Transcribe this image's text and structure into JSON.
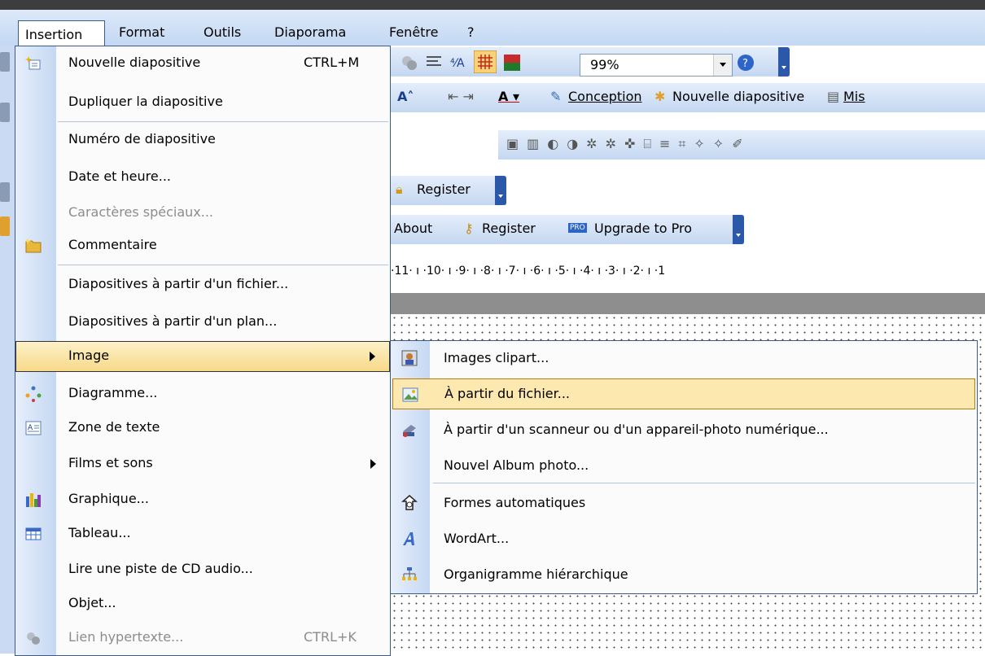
{
  "menubar": {
    "items": [
      {
        "label": "Insertion"
      },
      {
        "label": "Format"
      },
      {
        "label": "Outils"
      },
      {
        "label": "Diaporama"
      },
      {
        "label": "Fenêtre"
      },
      {
        "label": "?"
      }
    ]
  },
  "toolbars": {
    "zoom": "99%",
    "conception": "Conception",
    "nouvelle_diapositive": "Nouvelle diapositive",
    "mise": "Mis",
    "register1": "Register",
    "about": "About",
    "register2": "Register",
    "upgrade": "Upgrade to Pro",
    "ruler": "·11· ı ·10· ı ·9· ı ·8· ı ·7· ı ·6· ı ·5· ı ·4· ı ·3· ı ·2· ı ·1"
  },
  "menu": {
    "items": [
      {
        "label": "Nouvelle diapositive",
        "shortcut": "CTRL+M",
        "icon": "new-slide-icon"
      },
      {
        "label": "Dupliquer la diapositive"
      },
      {
        "label": "Numéro de diapositive"
      },
      {
        "label": "Date et heure..."
      },
      {
        "label": "Caractères spéciaux..."
      },
      {
        "label": "Commentaire",
        "icon": "comment-icon"
      },
      {
        "label": "Diapositives à partir d'un fichier..."
      },
      {
        "label": "Diapositives à partir d'un plan..."
      },
      {
        "label": "Image"
      },
      {
        "label": "Diagramme...",
        "icon": "diagram-icon"
      },
      {
        "label": "Zone de texte",
        "icon": "textbox-icon"
      },
      {
        "label": "Films et sons"
      },
      {
        "label": "Graphique...",
        "icon": "chart-icon"
      },
      {
        "label": "Tableau...",
        "icon": "table-icon"
      },
      {
        "label": "Lire une piste de CD audio..."
      },
      {
        "label": "Objet..."
      },
      {
        "label": "Lien hypertexte...",
        "shortcut": "CTRL+K",
        "icon": "hyperlink-icon"
      }
    ]
  },
  "submenu": {
    "items": [
      {
        "label": "Images clipart...",
        "icon": "clipart-icon"
      },
      {
        "label": "À partir du fichier...",
        "icon": "picture-file-icon"
      },
      {
        "label": "À partir d'un scanneur ou d'un appareil-photo numérique...",
        "icon": "scanner-icon"
      },
      {
        "label": "Nouvel Album photo..."
      },
      {
        "label": "Formes automatiques",
        "icon": "autoshapes-icon"
      },
      {
        "label": "WordArt...",
        "icon": "wordart-icon"
      },
      {
        "label": "Organigramme hiérarchique",
        "icon": "org-chart-icon"
      }
    ]
  }
}
